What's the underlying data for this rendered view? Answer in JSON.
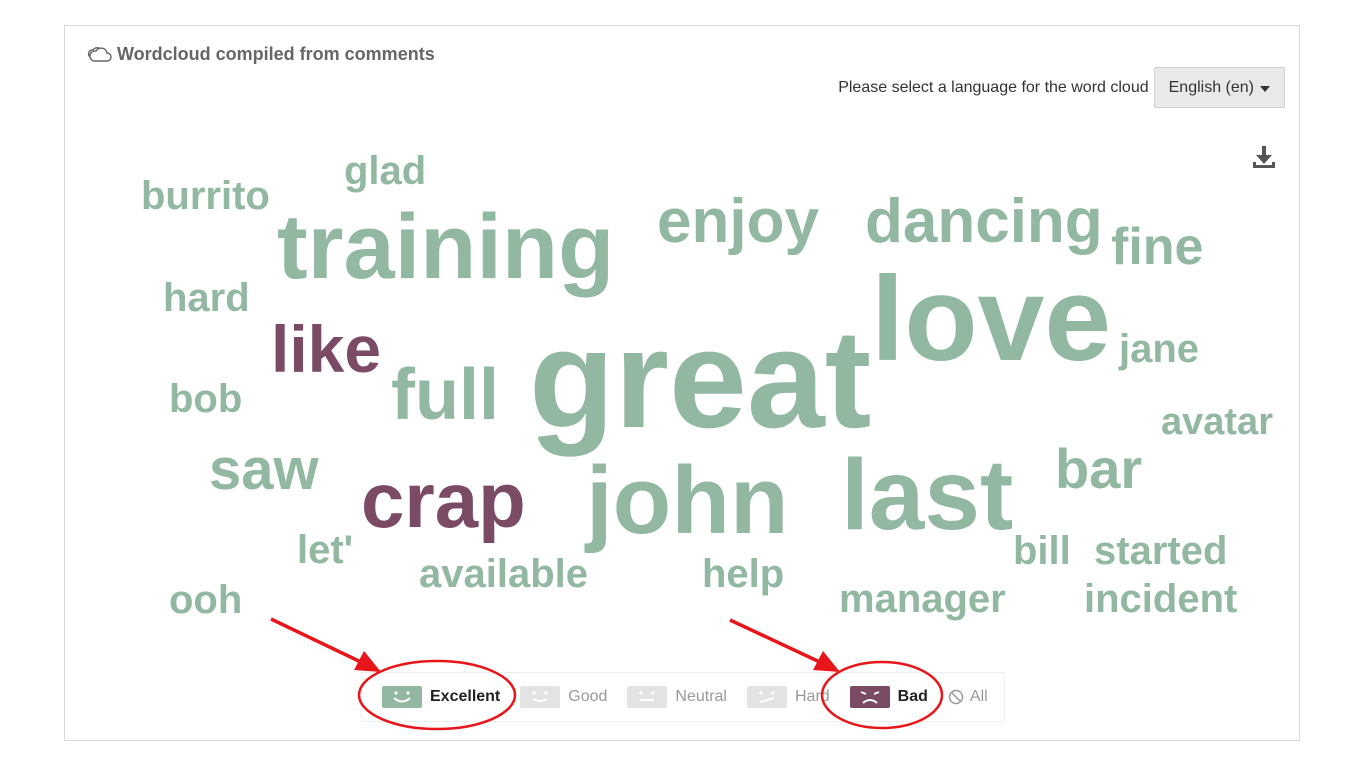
{
  "header": {
    "title": "Wordcloud compiled from comments",
    "title_icon": "cloud-icon"
  },
  "language": {
    "label": "Please select a language for the word cloud",
    "selected": "English (en)"
  },
  "toolbar": {
    "download_icon": "download-icon"
  },
  "colors": {
    "positive": "#93b8a2",
    "negative": "#7b4a65",
    "annotation": "#e8161a"
  },
  "wordcloud": {
    "words": [
      {
        "text": "burrito",
        "weight": 2,
        "sentiment": "positive"
      },
      {
        "text": "glad",
        "weight": 2,
        "sentiment": "positive"
      },
      {
        "text": "training",
        "weight": 5,
        "sentiment": "positive"
      },
      {
        "text": "enjoy",
        "weight": 4,
        "sentiment": "positive"
      },
      {
        "text": "dancing",
        "weight": 4,
        "sentiment": "positive"
      },
      {
        "text": "fine",
        "weight": 3,
        "sentiment": "positive"
      },
      {
        "text": "hard",
        "weight": 2,
        "sentiment": "positive"
      },
      {
        "text": "like",
        "weight": 4,
        "sentiment": "negative"
      },
      {
        "text": "love",
        "weight": 6,
        "sentiment": "positive"
      },
      {
        "text": "great",
        "weight": 7,
        "sentiment": "positive"
      },
      {
        "text": "jane",
        "weight": 2,
        "sentiment": "positive"
      },
      {
        "text": "bob",
        "weight": 2,
        "sentiment": "positive"
      },
      {
        "text": "full",
        "weight": 4,
        "sentiment": "positive"
      },
      {
        "text": "avatar",
        "weight": 2,
        "sentiment": "positive"
      },
      {
        "text": "saw",
        "weight": 3,
        "sentiment": "positive"
      },
      {
        "text": "crap",
        "weight": 5,
        "sentiment": "negative"
      },
      {
        "text": "john",
        "weight": 5,
        "sentiment": "positive"
      },
      {
        "text": "last",
        "weight": 6,
        "sentiment": "positive"
      },
      {
        "text": "bar",
        "weight": 3,
        "sentiment": "positive"
      },
      {
        "text": "let'",
        "weight": 2,
        "sentiment": "positive"
      },
      {
        "text": "bill",
        "weight": 2,
        "sentiment": "positive"
      },
      {
        "text": "started",
        "weight": 2,
        "sentiment": "positive"
      },
      {
        "text": "available",
        "weight": 2,
        "sentiment": "positive"
      },
      {
        "text": "help",
        "weight": 2,
        "sentiment": "positive"
      },
      {
        "text": "ooh",
        "weight": 2,
        "sentiment": "positive"
      },
      {
        "text": "manager",
        "weight": 2,
        "sentiment": "positive"
      },
      {
        "text": "incident",
        "weight": 2,
        "sentiment": "positive"
      }
    ]
  },
  "filters": [
    {
      "label": "Excellent",
      "icon": "face-excellent-icon",
      "active": true,
      "color": "#93b8a2"
    },
    {
      "label": "Good",
      "icon": "face-good-icon",
      "active": false,
      "color": "#e3e3e3"
    },
    {
      "label": "Neutral",
      "icon": "face-neutral-icon",
      "active": false,
      "color": "#e3e3e3"
    },
    {
      "label": "Hard",
      "icon": "face-hard-icon",
      "active": false,
      "color": "#e3e3e3"
    },
    {
      "label": "Bad",
      "icon": "face-bad-icon",
      "active": true,
      "color": "#7b4a65"
    },
    {
      "label": "All",
      "icon": "ban-icon",
      "active": false
    }
  ]
}
